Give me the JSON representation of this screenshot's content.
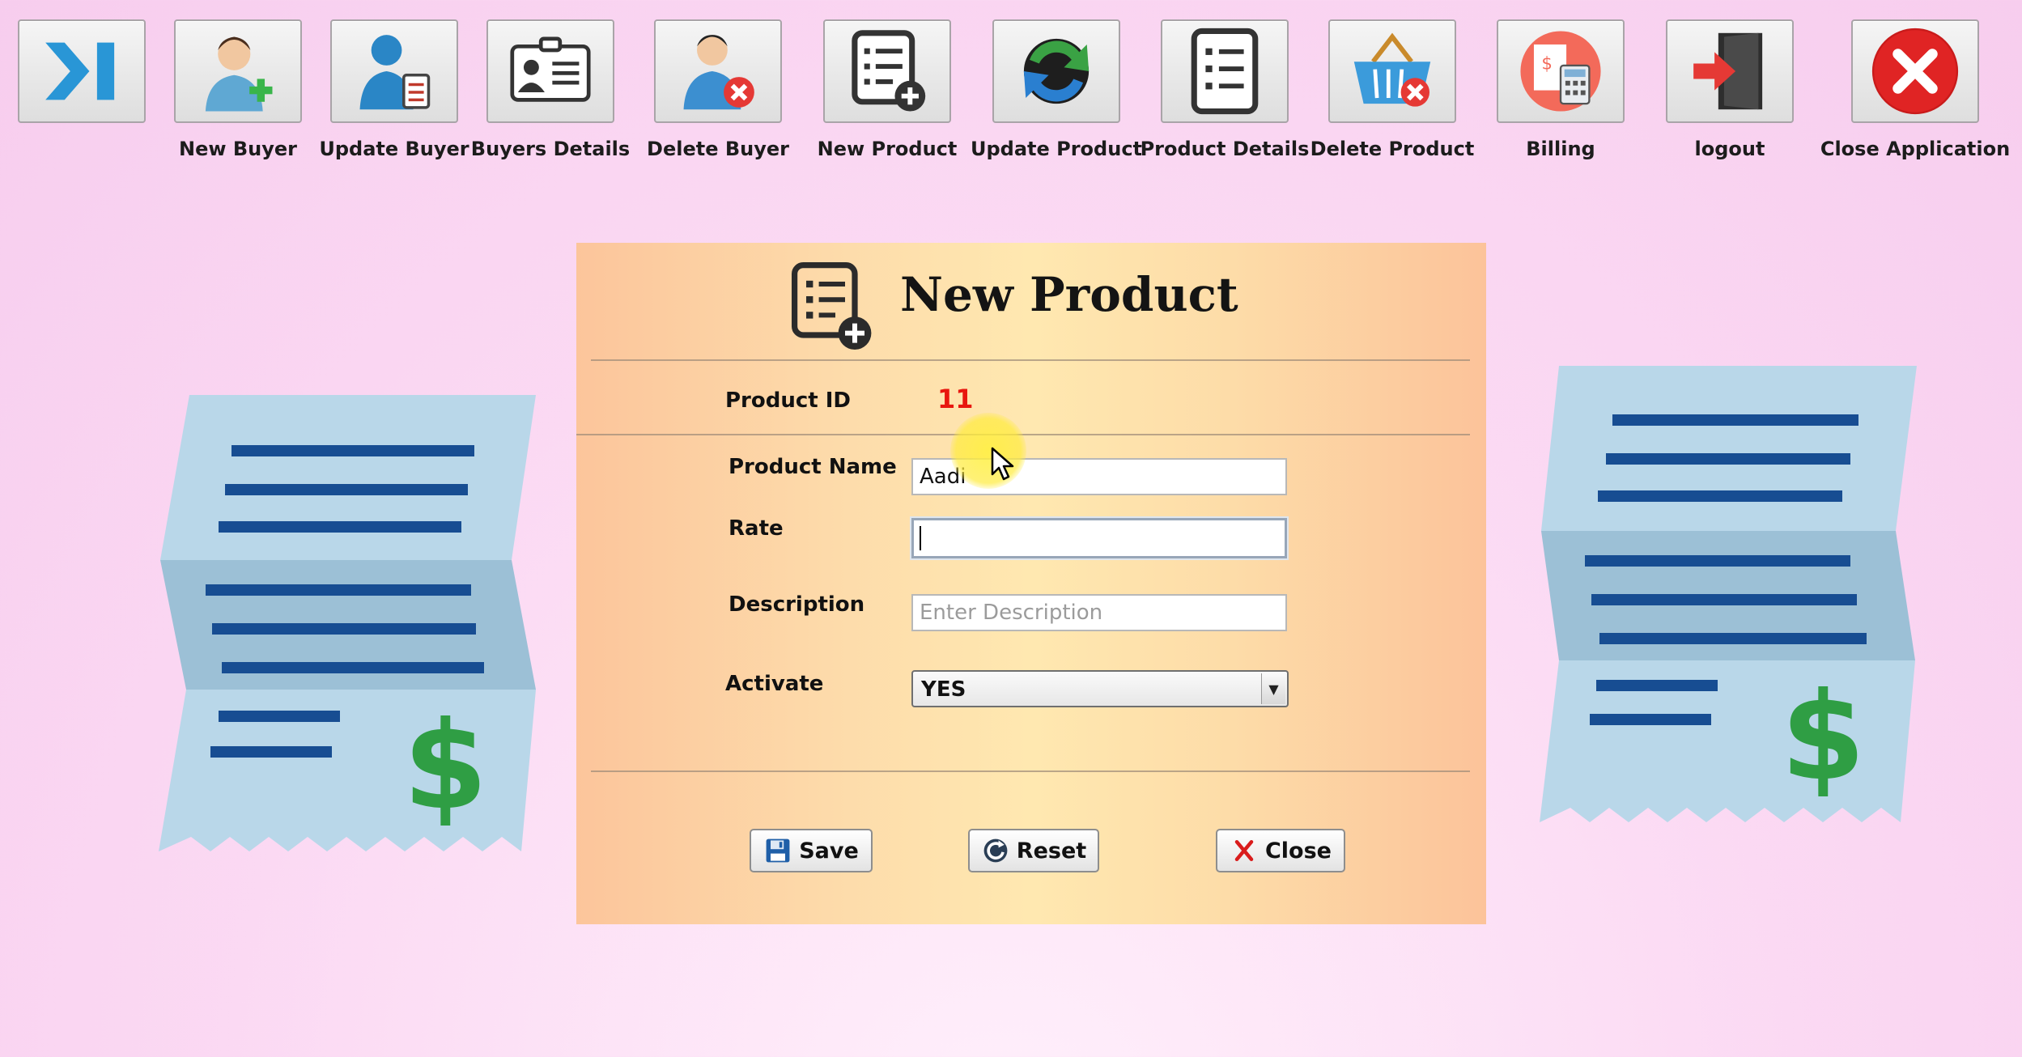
{
  "toolbar": {
    "items": [
      {
        "label": "",
        "icon": "collapse-arrow-icon"
      },
      {
        "label": "New Buyer",
        "icon": "new-buyer-icon"
      },
      {
        "label": "Update Buyer",
        "icon": "update-buyer-icon"
      },
      {
        "label": "Buyers Details",
        "icon": "id-card-icon"
      },
      {
        "label": "Delete Buyer",
        "icon": "delete-buyer-icon"
      },
      {
        "label": "New Product",
        "icon": "new-product-icon"
      },
      {
        "label": "Update Product",
        "icon": "refresh-icon"
      },
      {
        "label": "Product Details",
        "icon": "list-icon"
      },
      {
        "label": "Delete Product",
        "icon": "basket-delete-icon"
      },
      {
        "label": "Billing",
        "icon": "billing-icon"
      },
      {
        "label": "logout",
        "icon": "logout-door-icon"
      },
      {
        "label": "Close Application",
        "icon": "close-circle-icon"
      }
    ]
  },
  "form": {
    "title": "New Product",
    "product_id_label": "Product ID",
    "product_id_value": "11",
    "product_name_label": "Product Name",
    "product_name_value": "Aadi",
    "rate_label": "Rate",
    "rate_value": "",
    "description_label": "Description",
    "description_placeholder": "Enter Description",
    "activate_label": "Activate",
    "activate_value": "YES"
  },
  "buttons": {
    "save": "Save",
    "reset": "Reset",
    "close": "Close"
  },
  "colors": {
    "product_id": "#e8170f",
    "receipt_paper": "#b9d7e9",
    "receipt_lines": "#174d92",
    "dollar": "#2f9e44"
  }
}
